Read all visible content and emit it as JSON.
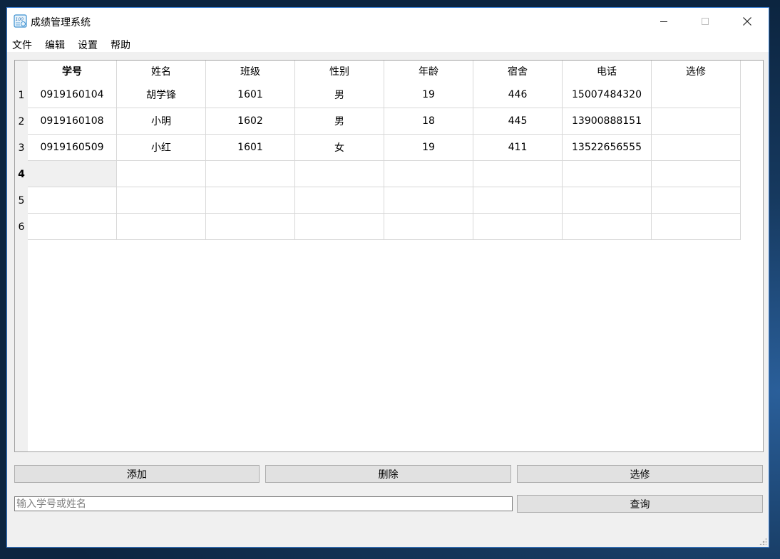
{
  "window": {
    "title": "成绩管理系统",
    "icon": "report-card-icon"
  },
  "window_controls": {
    "minimize": "—",
    "maximize": "☐",
    "close": "✕"
  },
  "menu": [
    "文件",
    "编辑",
    "设置",
    "帮助"
  ],
  "table": {
    "columns": [
      "学号",
      "姓名",
      "班级",
      "性别",
      "年龄",
      "宿舍",
      "电话",
      "选修"
    ],
    "row_numbers": [
      "1",
      "2",
      "3",
      "4",
      "5",
      "6"
    ],
    "rows": [
      [
        "0919160104",
        "胡学锋",
        "1601",
        "男",
        "19",
        "446",
        "15007484320",
        ""
      ],
      [
        "0919160108",
        "小明",
        "1602",
        "男",
        "18",
        "445",
        "13900888151",
        ""
      ],
      [
        "0919160509",
        "小红",
        "1601",
        "女",
        "19",
        "411",
        "13522656555",
        ""
      ],
      [
        "",
        "",
        "",
        "",
        "",
        "",
        "",
        ""
      ],
      [
        "",
        "",
        "",
        "",
        "",
        "",
        "",
        ""
      ],
      [
        "",
        "",
        "",
        "",
        "",
        "",
        "",
        ""
      ]
    ],
    "current_row": 4,
    "current_col": 1,
    "bold_column": 1
  },
  "buttons": {
    "add": "添加",
    "delete": "删除",
    "elective": "选修",
    "query": "查询"
  },
  "search": {
    "placeholder": "输入学号或姓名",
    "value": ""
  }
}
